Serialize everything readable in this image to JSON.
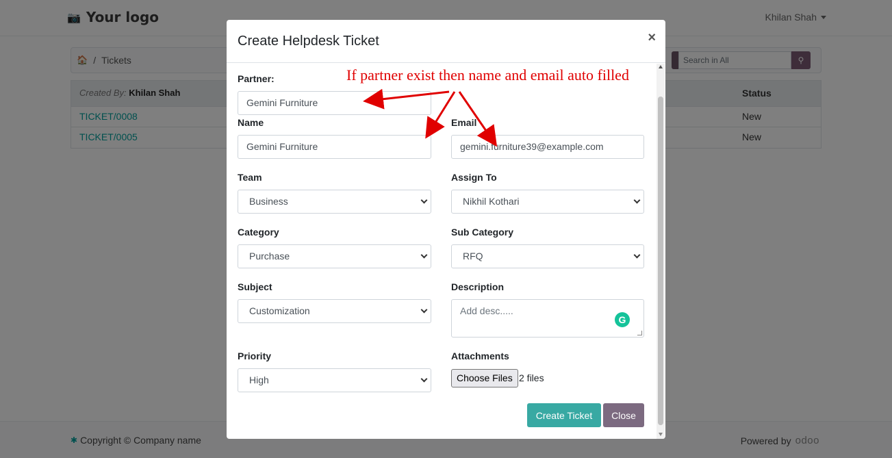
{
  "navbar": {
    "logo_text": "Your logo",
    "user_name": "Khilan Shah"
  },
  "breadcrumb": {
    "current": "Tickets",
    "separator": "/"
  },
  "search": {
    "placeholder": "Search in All"
  },
  "table": {
    "created_by_label": "Created By:",
    "created_by_value": "Khilan Shah",
    "status_header": "Status",
    "rows": [
      {
        "id": "TICKET/0008",
        "status": "New"
      },
      {
        "id": "TICKET/0005",
        "status": "New"
      }
    ]
  },
  "footer": {
    "copyright": "Copyright © Company name",
    "powered_by": "Powered by",
    "brand": "odoo"
  },
  "modal": {
    "title": "Create Helpdesk Ticket",
    "close_symbol": "×",
    "annotation": "If partner exist then name and email auto filled",
    "partner": {
      "label": "Partner:",
      "value": "Gemini Furniture"
    },
    "name": {
      "label": "Name",
      "value": "Gemini Furniture"
    },
    "email": {
      "label": "Email",
      "value": "gemini.furniture39@example.com"
    },
    "team": {
      "label": "Team",
      "value": "Business"
    },
    "assign_to": {
      "label": "Assign To",
      "value": "Nikhil Kothari"
    },
    "category": {
      "label": "Category",
      "value": "Purchase"
    },
    "sub_category": {
      "label": "Sub Category",
      "value": "RFQ"
    },
    "subject": {
      "label": "Subject",
      "value": "Customization"
    },
    "description": {
      "label": "Description",
      "placeholder": "Add desc....."
    },
    "priority": {
      "label": "Priority",
      "value": "High"
    },
    "attachments": {
      "label": "Attachments",
      "button": "Choose Files",
      "count": "2 files"
    },
    "create_button": "Create Ticket",
    "close_button": "Close"
  },
  "colors": {
    "accent_teal": "#38a9a3",
    "close_purple": "#7c6a80",
    "annotation_red": "#e00000",
    "link_teal": "#00a09d"
  }
}
